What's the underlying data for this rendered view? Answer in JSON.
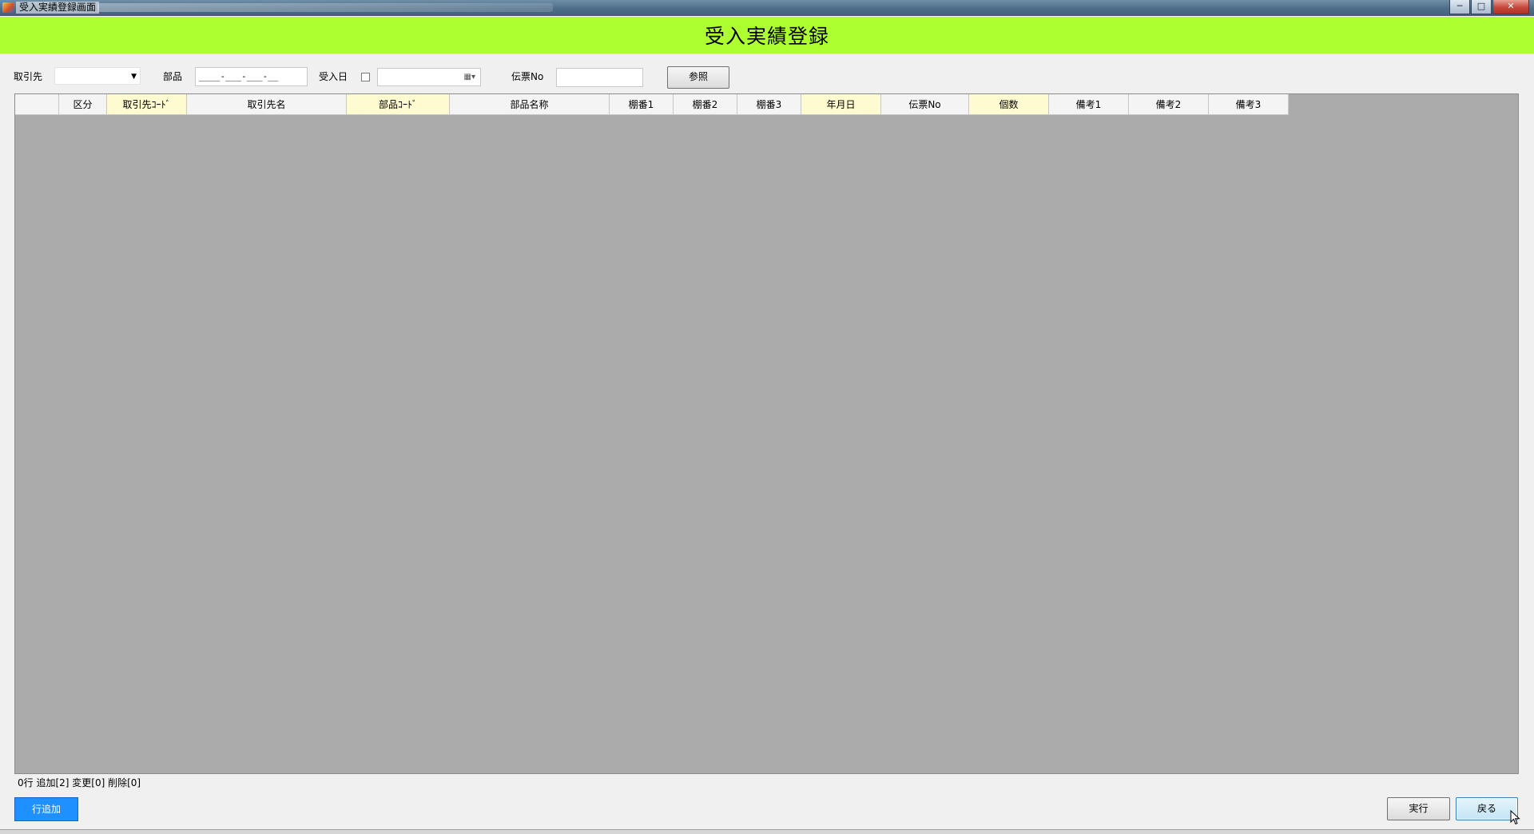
{
  "window": {
    "title": "受入実績登録画面",
    "controls": {
      "minimize": "─",
      "maximize": "□",
      "close": "✕"
    }
  },
  "header": {
    "title": "受入実績登録"
  },
  "filters": {
    "torihikisaki_label": "取引先",
    "torihikisaki_value": "",
    "buhin_label": "部品",
    "buhin_mask": "____-___-___-__",
    "ukeirebi_label": "受入日",
    "ukeirebi_checked": false,
    "denpyo_label": "伝票No",
    "denpyo_value": "",
    "reference_button": "参照"
  },
  "grid": {
    "columns": [
      "",
      "区分",
      "取引先ｺｰﾄﾞ",
      "取引先名",
      "部品ｺｰﾄﾞ",
      "部品名称",
      "棚番1",
      "棚番2",
      "棚番3",
      "年月日",
      "伝票No",
      "個数",
      "備考1",
      "備考2",
      "備考3"
    ],
    "rows": []
  },
  "status": {
    "text": "0行  追加[2]  変更[0]  削除[0]"
  },
  "buttons": {
    "add_row": "行追加",
    "execute": "実行",
    "back": "戻る"
  }
}
